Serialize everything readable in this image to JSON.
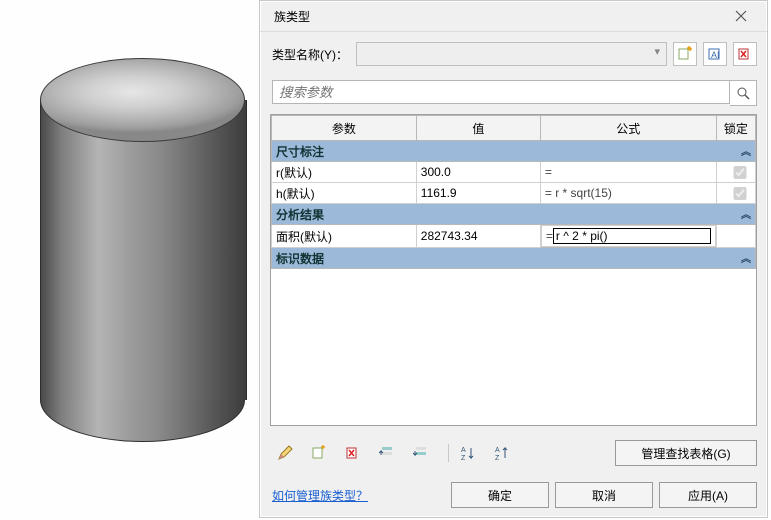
{
  "dialog": {
    "title": "族类型",
    "type_label": "类型名称(Y)：",
    "type_value": "",
    "search_placeholder": "搜索参数",
    "headers": {
      "param": "参数",
      "value": "值",
      "formula": "公式",
      "lock": "锁定"
    },
    "sections": {
      "dims": "尺寸标注",
      "analysis": "分析结果",
      "ident": "标识数据"
    },
    "rows": {
      "r": {
        "name": "r(默认)",
        "value": "300.0",
        "formula": "="
      },
      "h": {
        "name": "h(默认)",
        "value": "1161.9",
        "formula": "= r * sqrt(15)"
      },
      "area": {
        "name": "面积(默认)",
        "value": "282743.34",
        "formula_prefix": "=",
        "formula_edit": "r ^ 2 * pi()"
      }
    },
    "manage_lookup": "管理查找表格(G)",
    "help_link": "如何管理族类型？",
    "ok": "确定",
    "cancel": "取消",
    "apply": "应用(A)"
  },
  "icons": {
    "new_type": "new-type-icon",
    "rename_type": "rename-type-icon",
    "delete_type": "delete-type-icon",
    "search": "search-icon",
    "pencil": "pencil-icon",
    "new_param": "new-param-icon",
    "delete_param": "delete-param-icon",
    "moveup": "move-up-icon",
    "movedown": "move-down-icon",
    "sort_asc": "sort-asc-icon",
    "sort_desc": "sort-desc-icon",
    "close": "close-icon",
    "collapse": "collapse-icon"
  }
}
